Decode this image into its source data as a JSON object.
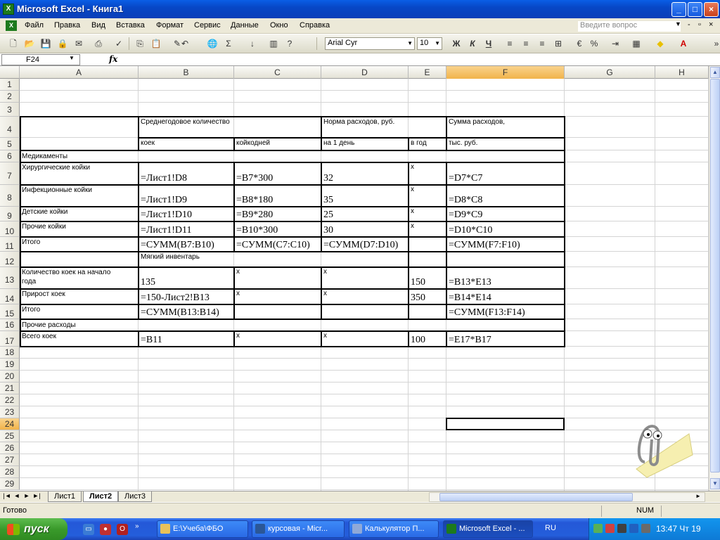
{
  "window": {
    "title": "Microsoft Excel - Книга1",
    "app_icon": "X",
    "minimize": "_",
    "maximize": "□",
    "close": "×"
  },
  "menu": {
    "items": [
      "Файл",
      "Правка",
      "Вид",
      "Вставка",
      "Формат",
      "Сервис",
      "Данные",
      "Окно",
      "Справка"
    ],
    "help_placeholder": "Введите вопрос",
    "doc_min": "-",
    "doc_restore": "▫",
    "doc_close": "×"
  },
  "toolbar": {
    "font_name": "Arial Cyr",
    "font_size": "10",
    "bold": "Ж",
    "italic": "К",
    "underline": "Ч",
    "percent": "%",
    "sum": "Σ"
  },
  "formula_bar": {
    "name_box": "F24",
    "fx": "fx",
    "formula": ""
  },
  "columns": [
    {
      "id": "A",
      "label": "A"
    },
    {
      "id": "B",
      "label": "B"
    },
    {
      "id": "C",
      "label": "C"
    },
    {
      "id": "D",
      "label": "D"
    },
    {
      "id": "E",
      "label": "E"
    },
    {
      "id": "F",
      "label": "F"
    },
    {
      "id": "G",
      "label": "G"
    },
    {
      "id": "H",
      "label": "H"
    }
  ],
  "rows": [
    "1",
    "2",
    "3",
    "4",
    "5",
    "6",
    "7",
    "8",
    "9",
    "10",
    "11",
    "12",
    "13",
    "14",
    "15",
    "16",
    "17",
    "18",
    "19",
    "20",
    "21",
    "22",
    "23",
    "24",
    "25",
    "26",
    "27",
    "28",
    "29"
  ],
  "selected": {
    "column": "F",
    "row": "24"
  },
  "cells": [
    {
      "ref": "B4",
      "text": "Среднегодовое количество",
      "big": false
    },
    {
      "ref": "D4",
      "text": "Норма расходов, руб.",
      "big": false
    },
    {
      "ref": "F4",
      "text": "Сумма расходов,",
      "big": false
    },
    {
      "ref": "B5",
      "text": "коек",
      "big": false
    },
    {
      "ref": "C5",
      "text": "койкодней",
      "big": false
    },
    {
      "ref": "D5",
      "text": "на 1 день",
      "big": false
    },
    {
      "ref": "E5",
      "text": "в год",
      "big": false
    },
    {
      "ref": "F5",
      "text": "тыс. руб.",
      "big": false
    },
    {
      "ref": "A6",
      "text": "Медикаменты",
      "big": false
    },
    {
      "ref": "A7",
      "text": "Хирургические койки",
      "big": false
    },
    {
      "ref": "B7",
      "text": "=Лист1!D8",
      "big": true
    },
    {
      "ref": "C7",
      "text": "=B7*300",
      "big": true
    },
    {
      "ref": "D7",
      "text": "32",
      "big": true
    },
    {
      "ref": "E7",
      "text": "х",
      "big": false
    },
    {
      "ref": "F7",
      "text": "=D7*C7",
      "big": true
    },
    {
      "ref": "A8",
      "text": "Инфекционные койки",
      "big": false
    },
    {
      "ref": "B8",
      "text": "=Лист1!D9",
      "big": true
    },
    {
      "ref": "C8",
      "text": "=B8*180",
      "big": true
    },
    {
      "ref": "D8",
      "text": "35",
      "big": true
    },
    {
      "ref": "E8",
      "text": "х",
      "big": false
    },
    {
      "ref": "F8",
      "text": "=D8*C8",
      "big": true
    },
    {
      "ref": "A9",
      "text": "Детские койки",
      "big": false
    },
    {
      "ref": "B9",
      "text": "=Лист1!D10",
      "big": true
    },
    {
      "ref": "C9",
      "text": "=B9*280",
      "big": true
    },
    {
      "ref": "D9",
      "text": "25",
      "big": true
    },
    {
      "ref": "E9",
      "text": "х",
      "big": false
    },
    {
      "ref": "F9",
      "text": "=D9*C9",
      "big": true
    },
    {
      "ref": "A10",
      "text": "Прочие койки",
      "big": false
    },
    {
      "ref": "B10",
      "text": "=Лист1!D11",
      "big": true
    },
    {
      "ref": "C10",
      "text": "=B10*300",
      "big": true
    },
    {
      "ref": "D10",
      "text": "30",
      "big": true
    },
    {
      "ref": "E10",
      "text": "х",
      "big": false
    },
    {
      "ref": "F10",
      "text": "=D10*C10",
      "big": true
    },
    {
      "ref": "A11",
      "text": "Итого",
      "big": false
    },
    {
      "ref": "B11",
      "text": "=СУММ(B7:B10)",
      "big": true
    },
    {
      "ref": "C11",
      "text": "=СУММ(C7:C10)",
      "big": true
    },
    {
      "ref": "D11",
      "text": "=СУММ(D7:D10)",
      "big": true
    },
    {
      "ref": "F11",
      "text": "=СУММ(F7:F10)",
      "big": true
    },
    {
      "ref": "B12",
      "text": "Мягкий инвентарь",
      "big": false
    },
    {
      "ref": "A13",
      "text": "Количество   коек   на   начало",
      "big": false
    },
    {
      "ref": "A13b",
      "text": "года",
      "big": false
    },
    {
      "ref": "B13",
      "text": "135",
      "big": true
    },
    {
      "ref": "C13",
      "text": "х",
      "big": false
    },
    {
      "ref": "D13",
      "text": "х",
      "big": false
    },
    {
      "ref": "E13",
      "text": "150",
      "big": true
    },
    {
      "ref": "F13",
      "text": "=B13*E13",
      "big": true
    },
    {
      "ref": "A14",
      "text": "Прирост коек",
      "big": false
    },
    {
      "ref": "B14",
      "text": "=150-Лист2!B13",
      "big": true
    },
    {
      "ref": "C14",
      "text": "х",
      "big": false
    },
    {
      "ref": "D14",
      "text": "х",
      "big": false
    },
    {
      "ref": "E14",
      "text": "350",
      "big": true
    },
    {
      "ref": "F14",
      "text": "=B14*E14",
      "big": true
    },
    {
      "ref": "A15",
      "text": "Итого",
      "big": false
    },
    {
      "ref": "B15",
      "text": "=СУММ(B13:B14)",
      "big": true
    },
    {
      "ref": "F15",
      "text": "=СУММ(F13:F14)",
      "big": true
    },
    {
      "ref": "A16",
      "text": "Прочие расходы",
      "big": false
    },
    {
      "ref": "A17",
      "text": "Всего коек",
      "big": false
    },
    {
      "ref": "B17",
      "text": "=B11",
      "big": true
    },
    {
      "ref": "C17",
      "text": "х",
      "big": false
    },
    {
      "ref": "D17",
      "text": "х",
      "big": false
    },
    {
      "ref": "E17",
      "text": "100",
      "big": true
    },
    {
      "ref": "F17",
      "text": "=E17*B17",
      "big": true
    }
  ],
  "sheets": {
    "tabs": [
      "Лист1",
      "Лист2",
      "Лист3"
    ],
    "active": "Лист2"
  },
  "status": {
    "text": "Готово",
    "num": "NUM"
  },
  "taskbar": {
    "start": "пуск",
    "tasks": [
      {
        "label": "E:\\Учеба\\ФБО",
        "icon_color": "#e8c25a"
      },
      {
        "label": "курсовая - Micr...",
        "icon_color": "#2b5797"
      },
      {
        "label": "Калькулятор П...",
        "icon_color": "#8fa9d8"
      },
      {
        "label": "Microsoft Excel - ...",
        "icon_color": "#1d7a1d"
      }
    ],
    "active_task": 3,
    "lang": "RU",
    "clock": "13:47 Чт 19"
  }
}
